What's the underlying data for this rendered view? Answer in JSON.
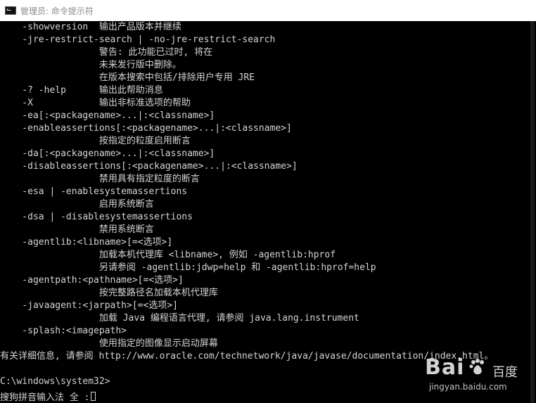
{
  "window": {
    "title": "管理员: 命令提示符",
    "icon": "console-icon"
  },
  "console": {
    "lines": [
      "    -showversion  输出产品版本并继续",
      "    -jre-restrict-search | -no-jre-restrict-search",
      "                  警告: 此功能已过时, 将在",
      "                  未来发行版中删除。",
      "                  在版本搜索中包括/排除用户专用 JRE",
      "    -? -help      输出此帮助消息",
      "    -X            输出非标准选项的帮助",
      "    -ea[:<packagename>...|:<classname>]",
      "    -enableassertions[:<packagename>...|:<classname>]",
      "                  按指定的粒度启用断言",
      "    -da[:<packagename>...|:<classname>]",
      "    -disableassertions[:<packagename>...|:<classname>]",
      "                  禁用具有指定粒度的断言",
      "    -esa | -enablesystemassertions",
      "                  启用系统断言",
      "    -dsa | -disablesystemassertions",
      "                  禁用系统断言",
      "    -agentlib:<libname>[=<选项>]",
      "                  加载本机代理库 <libname>, 例如 -agentlib:hprof",
      "                  另请参阅 -agentlib:jdwp=help 和 -agentlib:hprof=help",
      "    -agentpath:<pathname>[=<选项>]",
      "                  按完整路径名加载本机代理库",
      "    -javaagent:<jarpath>[=<选项>]",
      "                  加载 Java 编程语言代理, 请参阅 java.lang.instrument",
      "    -splash:<imagepath>",
      "                  使用指定的图像显示启动屏幕",
      "有关详细信息, 请参阅 http://www.oracle.com/technetwork/java/javase/documentation/index.html。",
      "",
      "C:\\windows\\system32>"
    ],
    "ime_status": "搜狗拼音输入法 全 :"
  },
  "watermark": {
    "logo": "Bai",
    "logo_suffix": "百度",
    "url": "jingyan.baidu.com",
    "icon": "baidu-paw-icon"
  },
  "colors": {
    "console_bg": "#000000",
    "console_fg": "#d4d4d4",
    "titlebar_bg": "#ffffff",
    "title_fg": "#8a8a8a"
  }
}
